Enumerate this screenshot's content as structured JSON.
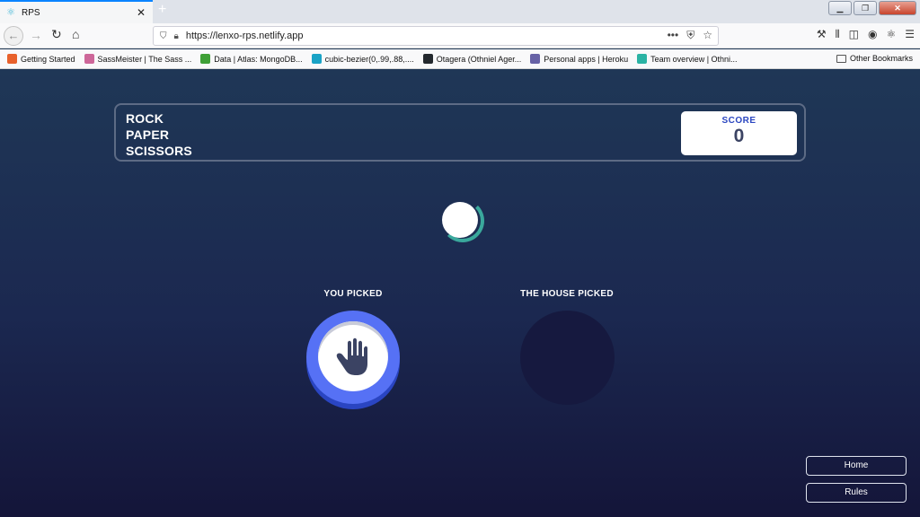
{
  "browser": {
    "tab_title": "RPS",
    "tab_close": "✕",
    "new_tab": "+",
    "url": "https://lenxo-rps.netlify.app",
    "url_menu": "•••",
    "bookmarks": [
      {
        "label": "Getting Started",
        "color": "#e8612c"
      },
      {
        "label": "SassMeister | The Sass ...",
        "color": "#cd6799"
      },
      {
        "label": "Data | Atlas: MongoDB...",
        "color": "#3fa037"
      },
      {
        "label": "cubic-bezier(0,.99,.88,....",
        "color": "#1aa3c6"
      },
      {
        "label": "Otagera (Othniel Ager...",
        "color": "#24292e"
      },
      {
        "label": "Personal apps | Heroku",
        "color": "#6762a6"
      },
      {
        "label": "Team overview | Othni...",
        "color": "#2bb3a4"
      }
    ],
    "other_bookmarks": "Other Bookmarks"
  },
  "app": {
    "logo_lines": [
      "ROCK",
      "PAPER",
      "SCISSORS"
    ],
    "score_label": "SCORE",
    "score_value": "0",
    "you_picked": "YOU PICKED",
    "house_picked": "THE HOUSE PICKED",
    "user_choice": "paper",
    "user_choice_icon": "hand-paper-icon",
    "home_button": "Home",
    "rules_button": "Rules",
    "colors": {
      "paper_ring": "#5671f5",
      "spinner_accent": "#3aa89c",
      "score_label": "#2a46c0"
    }
  }
}
